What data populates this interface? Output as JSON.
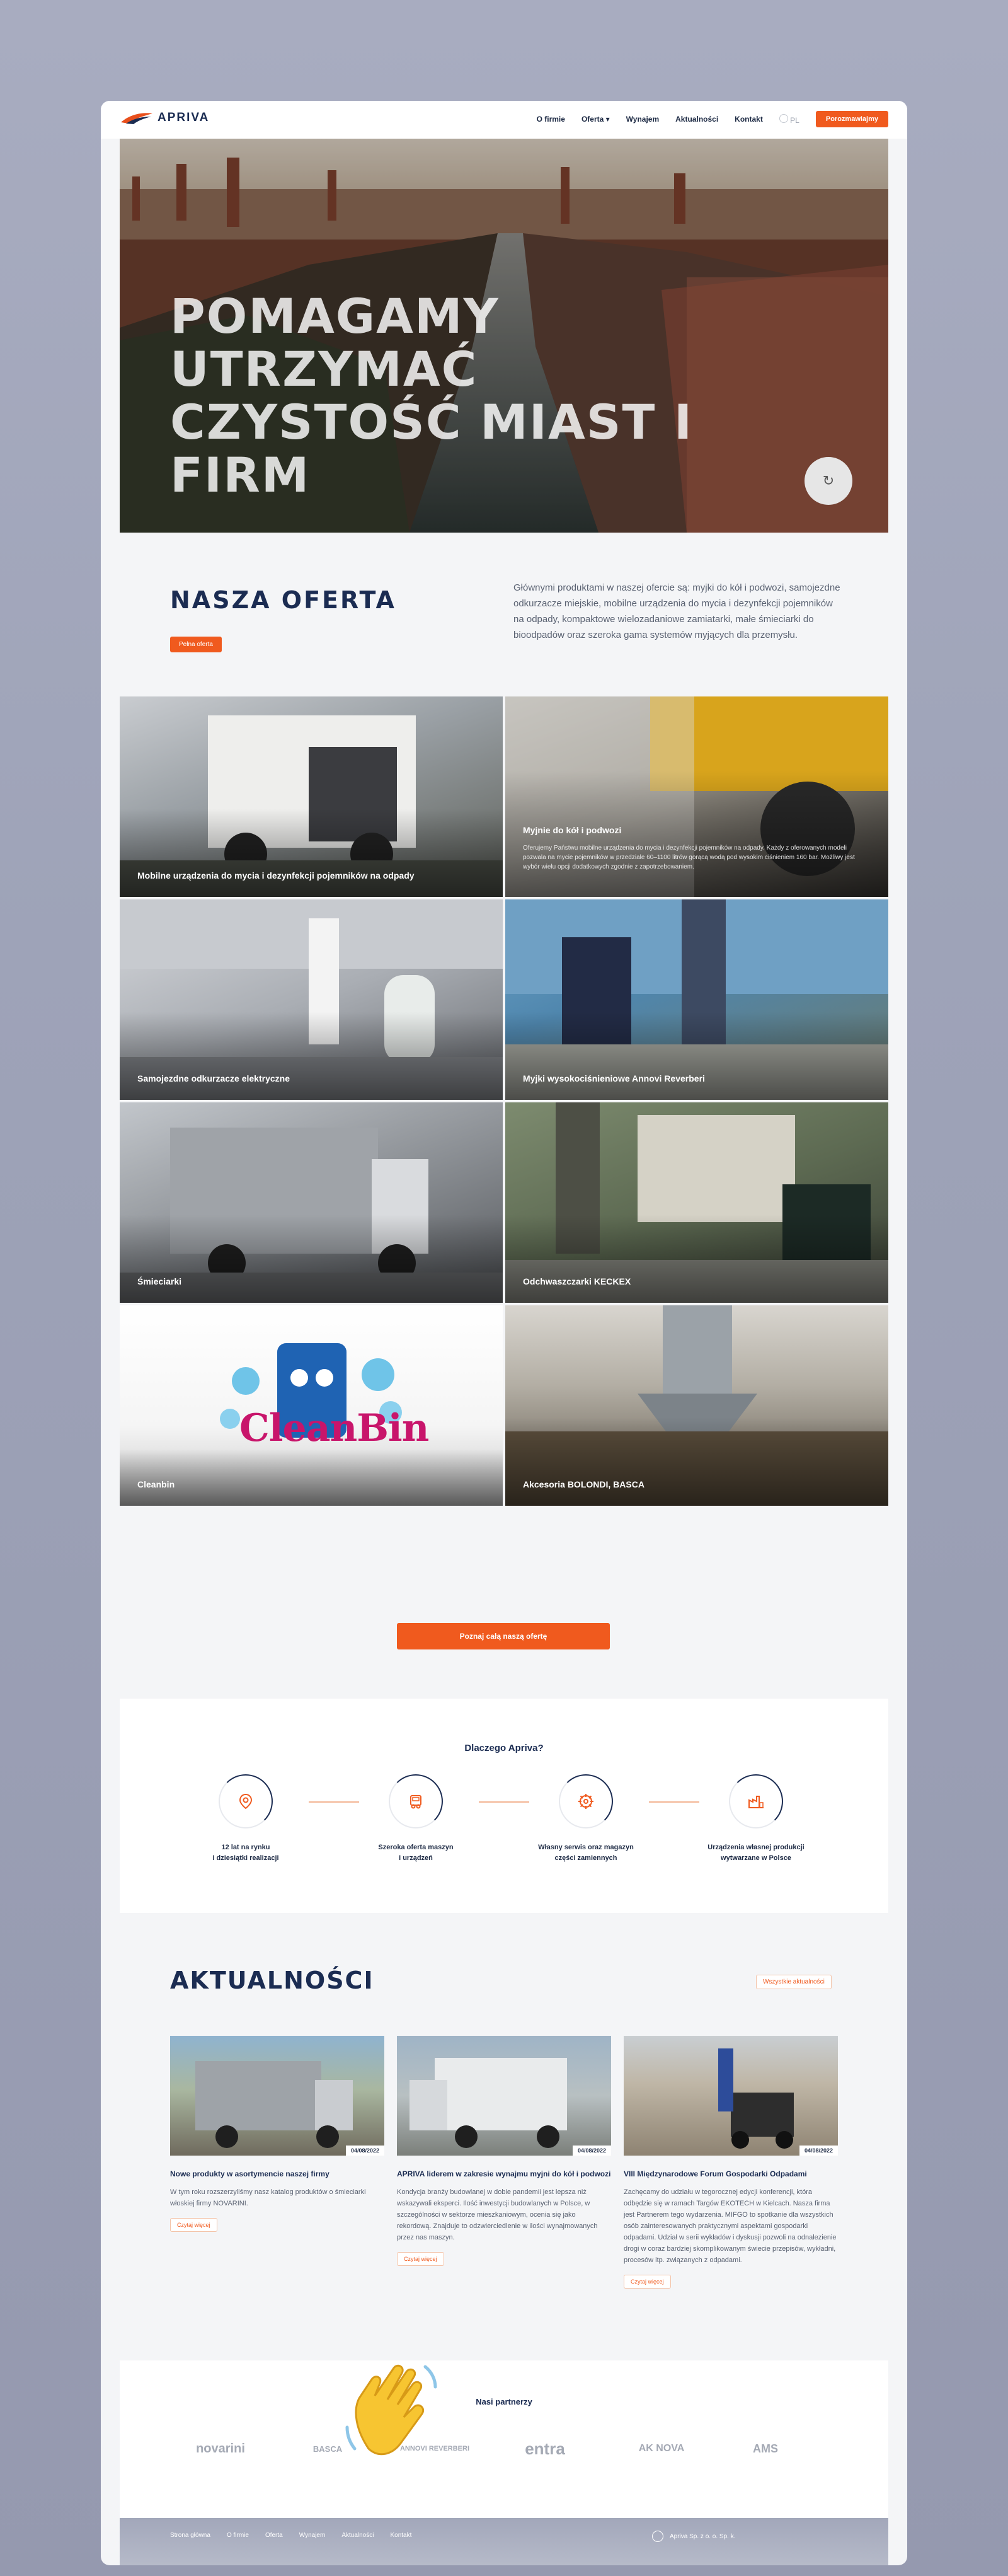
{
  "header": {
    "logo": "APRIVA",
    "nav": [
      "O firmie",
      "Oferta",
      "Wynajem",
      "Aktualności",
      "Kontakt"
    ],
    "oferta_chevron": "chevron-down-icon",
    "lang": "PL",
    "cta": "Porozmawiajmy"
  },
  "hero": {
    "title_line1": "POMAGAMY UTRZYMAĆ",
    "title_line2": "CZYSTOŚĆ MIAST I FIRM",
    "scroll_icon": "refresh-icon"
  },
  "offer": {
    "title": "NASZA OFERTA",
    "button": "Pełna oferta",
    "description": "Głównymi produktami w naszej ofercie są: myjki do kół i podwozi, samojezdne odkurzacze miejskie, mobilne urządzenia do mycia i dezynfekcji pojemników na odpady, kompaktowe wielozadaniowe zamiatarki, małe śmieciarki do bioodpadów oraz szeroka gama systemów myjących dla przemysłu.",
    "tiles": [
      {
        "label": "Mobilne urządzenia do mycia i dezynfekcji pojemników na odpady"
      },
      {
        "label": "Myjnie do kół i podwozi",
        "desc": "Oferujemy Państwu mobilne urządzenia do mycia i dezynfekcji pojemników na odpady. Każdy z oferowanych modeli pozwala na mycie pojemników w przedziale 60–1100 litrów gorącą wodą pod wysokim ciśnieniem 160 bar. Możliwy jest wybór wielu opcji dodatkowych zgodnie z zapotrzebowaniem."
      },
      {
        "label": "Samojezdne odkurzacze elektryczne"
      },
      {
        "label": "Myjki wysokociśnieniowe Annovi Reverberi"
      },
      {
        "label": "Śmieciarki"
      },
      {
        "label": "Odchwaszczarki KECKEX"
      },
      {
        "label": "Cleanbin",
        "logo": "CleanBin"
      },
      {
        "label": "Akcesoria BOLONDI, BASCA"
      }
    ],
    "all_button": "Poznaj całą naszą ofertę"
  },
  "why": {
    "title": "Dlaczego Apriva?",
    "items": [
      {
        "line1": "12 lat na rynku",
        "line2": "i dziesiątki realizacji",
        "icon": "location-pin-icon"
      },
      {
        "line1": "Szeroka oferta maszyn",
        "line2": "i urządzeń",
        "icon": "truck-icon"
      },
      {
        "line1": "Własny serwis oraz magazyn",
        "line2": "części zamiennych",
        "icon": "gear-icon"
      },
      {
        "line1": "Urządzenia własnej produkcji",
        "line2": "wytwarzane w Polsce",
        "icon": "factory-icon"
      }
    ]
  },
  "news": {
    "title": "AKTUALNOŚCI",
    "all_button": "Wszystkie aktualności",
    "items": [
      {
        "date": "04/08/2022",
        "title": "Nowe produkty w asortymencie naszej firmy",
        "text": "W tym roku rozszerzyliśmy nasz katalog produktów o śmieciarki włoskiej firmy NOVARINI.",
        "more": "Czytaj więcej"
      },
      {
        "date": "04/08/2022",
        "title": "APRIVA liderem w zakresie wynajmu myjni do kół i podwozi",
        "text": "Kondycja branży budowlanej w dobie pandemii jest lepsza niż wskazywali eksperci. Ilość inwestycji budowlanych w Polsce, w szczególności w sektorze mieszkaniowym, ocenia się jako rekordową. Znajduje to odzwierciedlenie w ilości wynajmowanych przez nas maszyn.",
        "more": "Czytaj więcej"
      },
      {
        "date": "04/08/2022",
        "title": "VIII Międzynarodowe Forum Gospodarki Odpadami",
        "text": "Zachęcamy do udziału w tegorocznej edycji konferencji, która odbędzie się w ramach Targów EKOTECH w Kielcach. Nasza firma jest Partnerem tego wydarzenia. MIFGO to spotkanie dla wszystkich osób zainteresowanych praktycznymi aspektami gospodarki odpadami. Udział w serii wykładów i dyskusji pozwoli na odnalezienie drogi w coraz bardziej skomplikowanym świecie przepisów, wykładni, procesów itp. związanych z odpadami.",
        "more": "Czytaj więcej"
      }
    ]
  },
  "partners": {
    "title": "Nasi partnerzy",
    "logos": [
      "novarini",
      "BASCA",
      "ANNOVI REVERBERI",
      "entra",
      "AK NOVA",
      "AMS"
    ]
  },
  "footer": {
    "nav": [
      "Strona główna",
      "O firmie",
      "Oferta",
      "Wynajem",
      "Aktualności",
      "Kontakt"
    ],
    "company": "Apriva Sp. z o. o. Sp. k."
  },
  "colors": {
    "accent": "#f05a1e",
    "navy": "#1b2c52"
  }
}
